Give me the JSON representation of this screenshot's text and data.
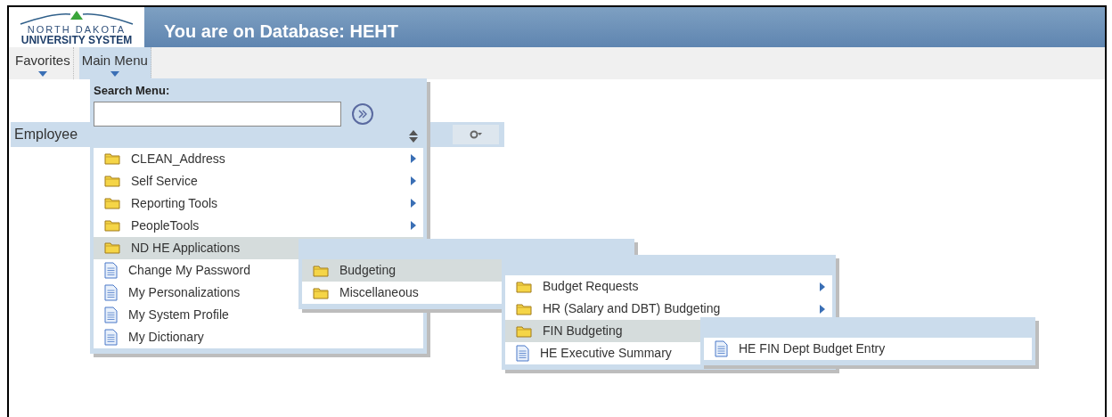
{
  "header": {
    "logo_top": "NORTH DAKOTA",
    "logo_bottom": "UNIVERSITY SYSTEM",
    "title": "You are on Database: HEHT"
  },
  "nav": [
    {
      "label": "Favorites",
      "selected": false
    },
    {
      "label": "Main Menu",
      "selected": true
    }
  ],
  "employee_bar": {
    "label": "Employee"
  },
  "main_menu": {
    "search_label": "Search Menu:",
    "items": [
      {
        "label": "CLEAN_Address",
        "kind": "folder",
        "submenu": true,
        "selected": false
      },
      {
        "label": "Self Service",
        "kind": "folder",
        "submenu": true,
        "selected": false
      },
      {
        "label": "Reporting Tools",
        "kind": "folder",
        "submenu": true,
        "selected": false
      },
      {
        "label": "PeopleTools",
        "kind": "folder",
        "submenu": true,
        "selected": false
      },
      {
        "label": "ND HE Applications",
        "kind": "folder",
        "selected": true
      },
      {
        "label": "Change My Password",
        "kind": "page",
        "selected": false
      },
      {
        "label": "My Personalizations",
        "kind": "page",
        "selected": false
      },
      {
        "label": "My System Profile",
        "kind": "page",
        "selected": false
      },
      {
        "label": "My Dictionary",
        "kind": "page",
        "selected": false
      }
    ]
  },
  "submenus": [
    {
      "items": [
        {
          "label": "Budgeting",
          "kind": "folder",
          "selected": true
        },
        {
          "label": "Miscellaneous",
          "kind": "folder",
          "selected": false
        }
      ]
    },
    {
      "items": [
        {
          "label": "Budget Requests",
          "kind": "folder",
          "submenu": true,
          "selected": false
        },
        {
          "label": "HR (Salary and DBT) Budgeting",
          "kind": "folder",
          "submenu": true,
          "selected": false
        },
        {
          "label": "FIN Budgeting",
          "kind": "folder",
          "selected": true
        },
        {
          "label": "HE Executive Summary",
          "kind": "page",
          "selected": false
        }
      ]
    },
    {
      "items": [
        {
          "label": "HE FIN Dept Budget Entry",
          "kind": "page",
          "selected": false
        }
      ]
    }
  ]
}
